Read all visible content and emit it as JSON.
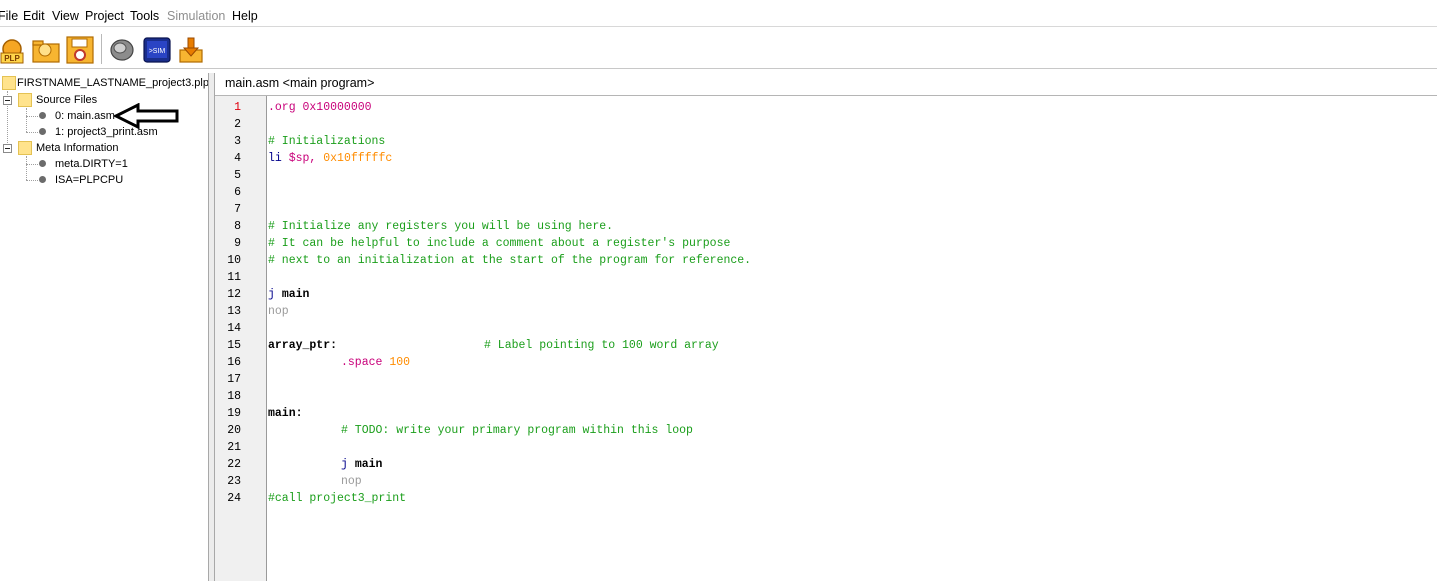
{
  "menu": {
    "items": [
      "File",
      "Edit",
      "View",
      "Project",
      "Tools",
      "Simulation",
      "Help"
    ]
  },
  "toolbar": {
    "buttons": [
      {
        "name": "new-project",
        "label": "PLP"
      },
      {
        "name": "open-project",
        "label": ""
      },
      {
        "name": "save-project",
        "label": ""
      },
      {
        "name": "assemble",
        "label": ""
      },
      {
        "name": "simulate",
        "label": ">SIM"
      },
      {
        "name": "download-to-board",
        "label": ""
      }
    ]
  },
  "tree": {
    "root": "FIRSTNAME_LASTNAME_project3.plp",
    "source_folder": "Source Files",
    "source_files": [
      "0: main.asm",
      "1: project3_print.asm"
    ],
    "meta_folder": "Meta Information",
    "meta_items": [
      "meta.DIRTY=1",
      "ISA=PLPCPU"
    ]
  },
  "editor": {
    "title": "main.asm <main program>",
    "current_line": 1,
    "line_numbers": [
      "1",
      "2",
      "3",
      "4",
      "5",
      "6",
      "7",
      "8",
      "9",
      "10",
      "11",
      "12",
      "13",
      "14",
      "15",
      "16",
      "17",
      "18",
      "19",
      "20",
      "21",
      "22",
      "23",
      "24"
    ],
    "code": {
      "l1": ".org 0x10000000",
      "l3": "# Initializations",
      "l4_instr": "li",
      "l4_reg": "$sp,",
      "l4_num": "0x10fffffc",
      "l8": "# Initialize any registers you will be using here.",
      "l9": "# It can be helpful to include a comment about a register's purpose",
      "l10": "# next to an initialization at the start of the program for reference.",
      "l12_instr": "j",
      "l12_label": "main",
      "l13": "nop",
      "l15_label": "array_ptr:",
      "l15_comment": "# Label pointing to 100 word array",
      "l16_dir": ".space",
      "l16_num": "100",
      "l19": "main:",
      "l20": "# TODO: write your primary program within this loop",
      "l22_instr": "j",
      "l22_label": "main",
      "l23": "nop",
      "l24": "#call project3_print"
    }
  },
  "colors": {
    "directive": "#c8007a",
    "number": "#ff8c00",
    "instruction": "#00008b",
    "comment": "#1a9e1a",
    "nop": "#9a9a9a",
    "current_line_number": "#e0000f"
  }
}
